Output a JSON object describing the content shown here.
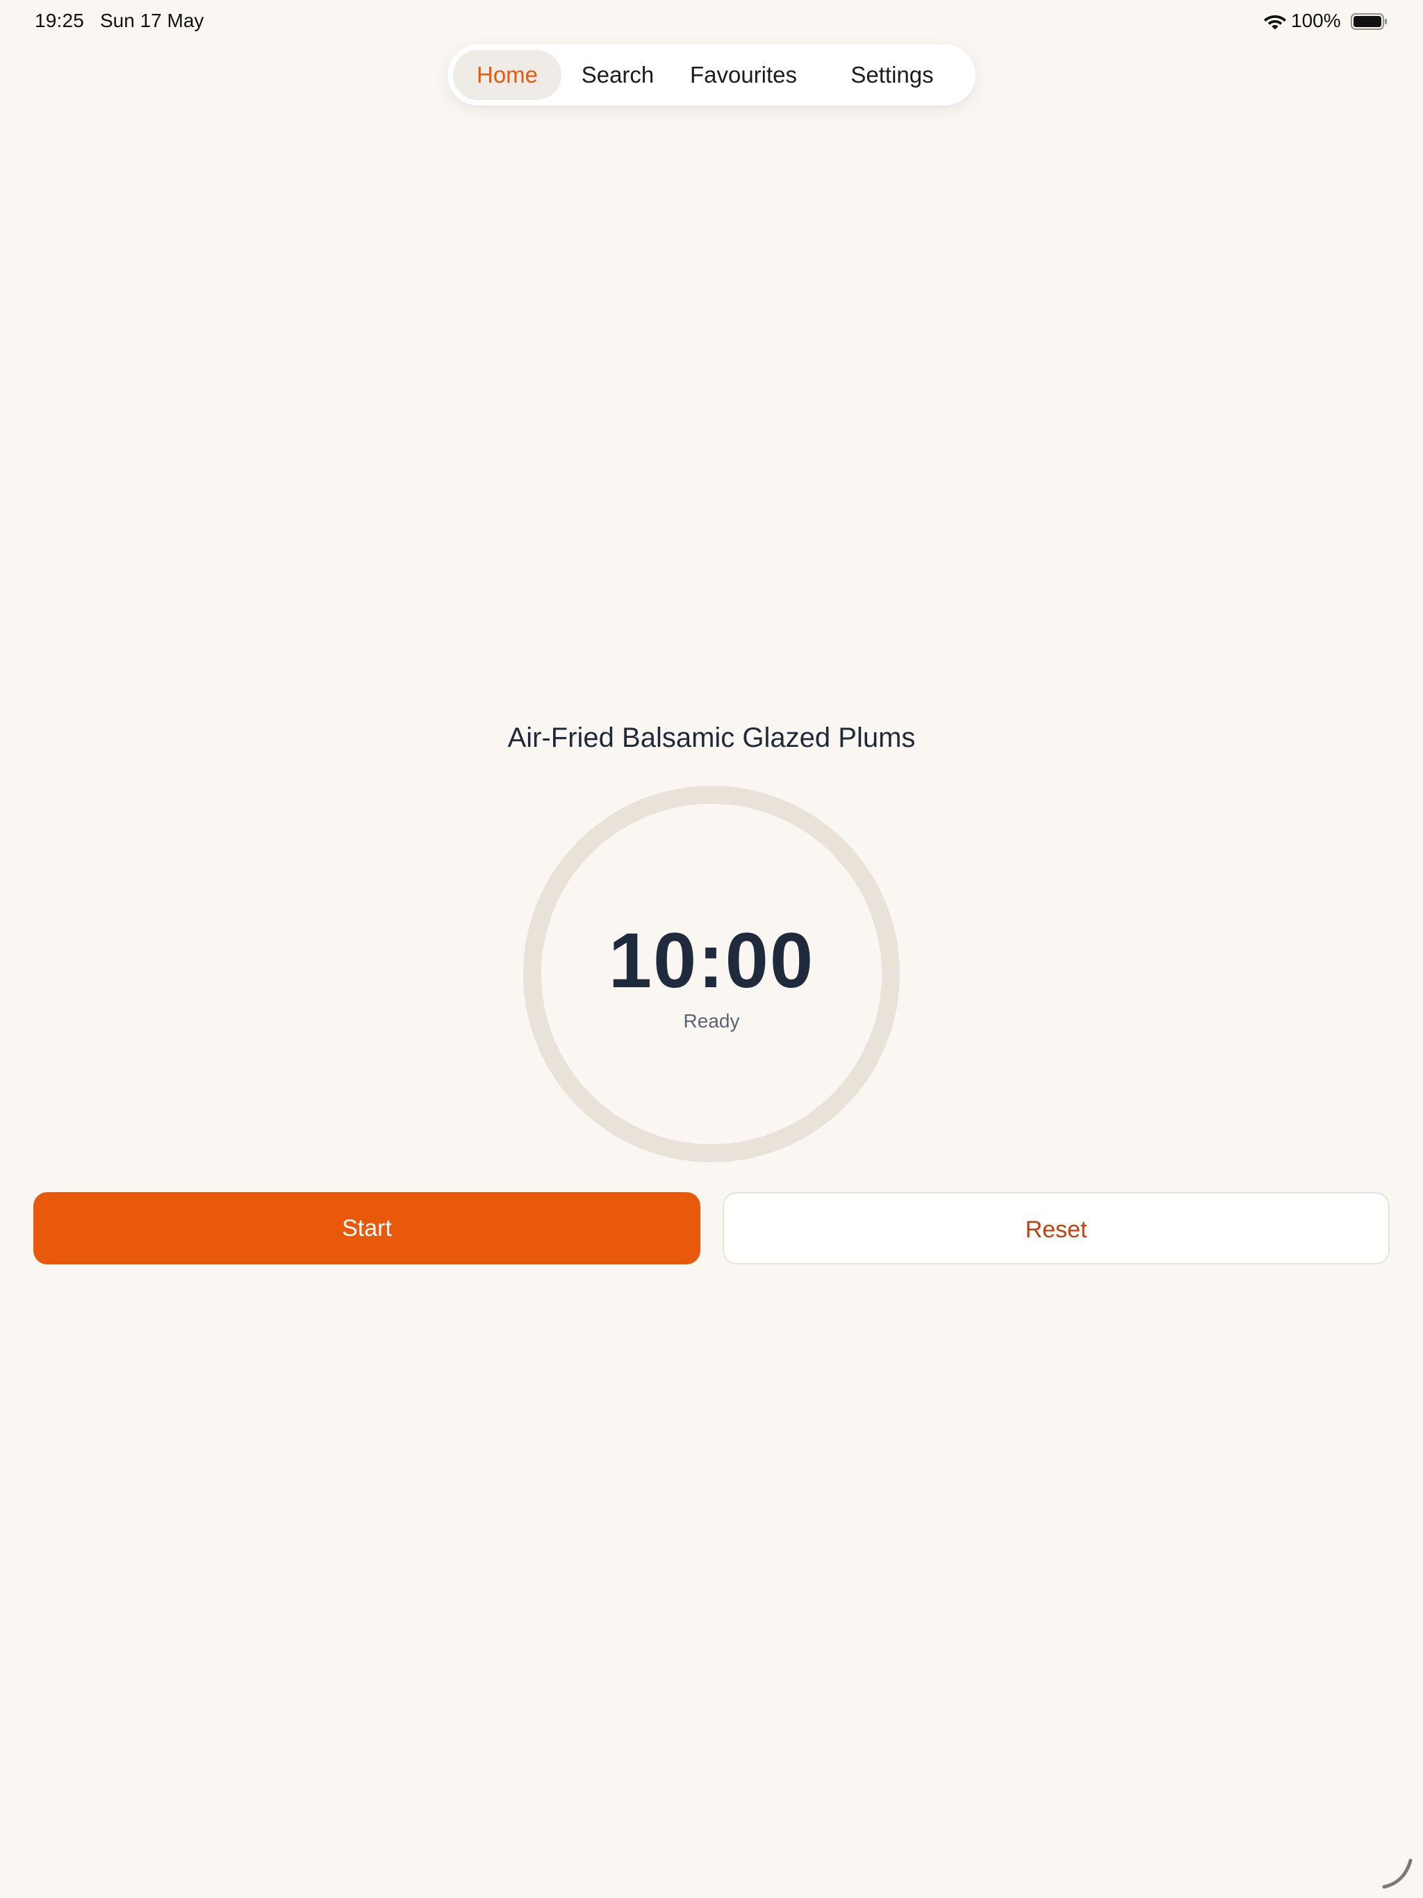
{
  "status_bar": {
    "time": "19:25",
    "date": "Sun 17 May",
    "battery_percent": "100%",
    "wifi_icon": "wifi-icon",
    "battery_icon": "battery-full-icon"
  },
  "nav": {
    "tabs": [
      {
        "label": "Home",
        "active": true
      },
      {
        "label": "Search",
        "active": false
      },
      {
        "label": "Favourites",
        "active": false
      },
      {
        "label": "Settings",
        "active": false
      }
    ]
  },
  "timer": {
    "recipe_name": "Air-Fried Balsamic Glazed Plums",
    "time_display": "10:00",
    "status": "Ready",
    "progress": 0
  },
  "buttons": {
    "start_label": "Start",
    "reset_label": "Reset"
  },
  "colors": {
    "accent": "#e8590c",
    "background": "#faf7f3",
    "ring_track": "#e9e2d8",
    "text_primary": "#1f2a3c"
  }
}
